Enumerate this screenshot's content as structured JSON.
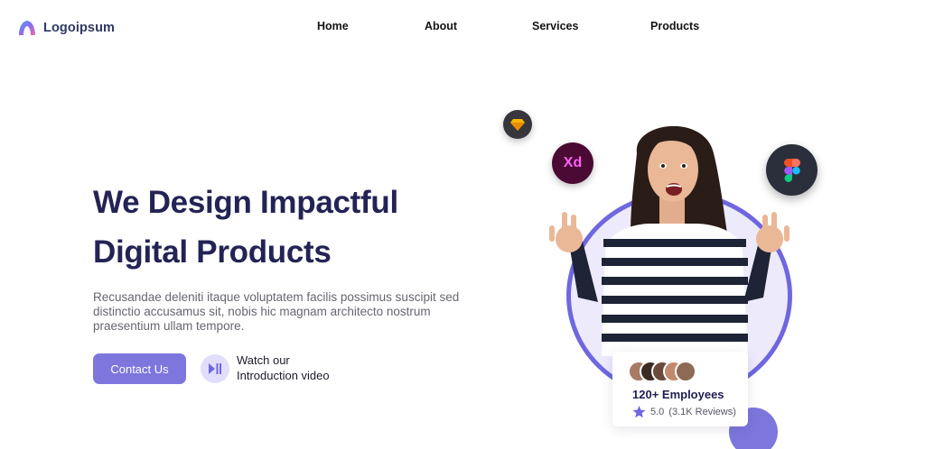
{
  "brand": {
    "name": "Logoipsum"
  },
  "nav": {
    "items": [
      "Home",
      "About",
      "Services",
      "Products"
    ]
  },
  "hero": {
    "title_line1": "We Design Impactful",
    "title_line2": "Digital Products",
    "description": "Recusandae deleniti itaque voluptatem facilis possimus suscipit sed distinctio accusamus sit, nobis hic magnam architecto nostrum praesentium ullam tempore.",
    "contact_label": "Contact Us",
    "video_line1": "Watch our",
    "video_line2": "Introduction video"
  },
  "badges": {
    "xd_label": "Xd"
  },
  "card": {
    "title": "120+ Employees",
    "rating": "5.0",
    "reviews": "(3.1K Reviews)"
  },
  "colors": {
    "accent": "#7d76dd",
    "ring": "#6f67df",
    "heading": "#232355"
  },
  "icons": [
    "logo-mark-icon",
    "play-pause-icon",
    "sketch-icon",
    "adobe-xd-icon",
    "figma-icon",
    "star-icon"
  ]
}
